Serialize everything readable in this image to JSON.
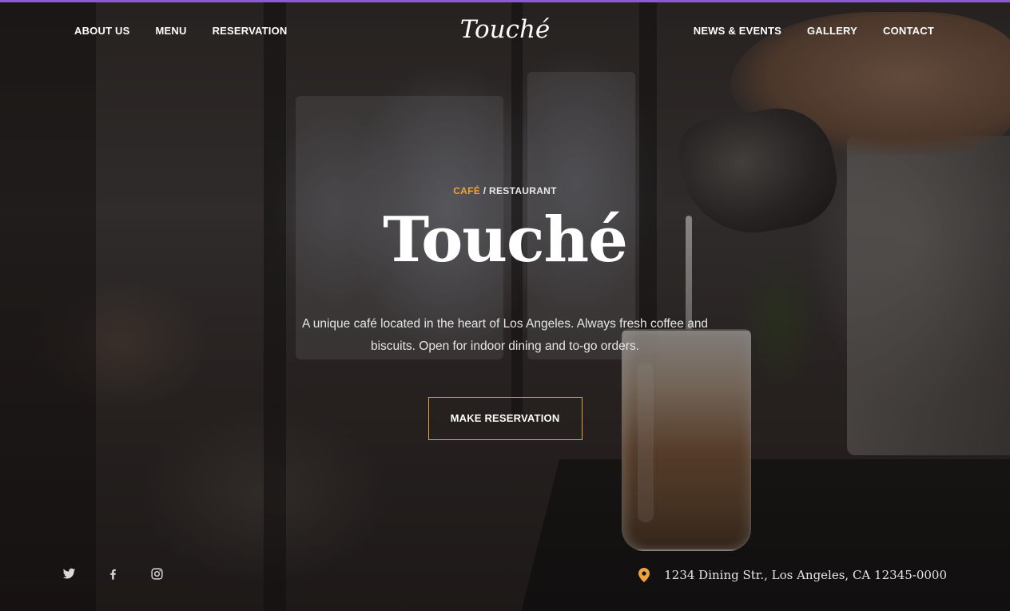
{
  "brand": {
    "logo": "Touché",
    "accent_color": "#f2a23a",
    "top_strip_color": "#8a5cd0"
  },
  "nav": {
    "left": [
      {
        "label": "ABOUT US"
      },
      {
        "label": "MENU"
      },
      {
        "label": "RESERVATION"
      }
    ],
    "right": [
      {
        "label": "NEWS & EVENTS"
      },
      {
        "label": "GALLERY"
      },
      {
        "label": "CONTACT"
      }
    ]
  },
  "hero": {
    "eyebrow_accent": "CAFÉ",
    "eyebrow_sep": " / ",
    "eyebrow_rest": "RESTAURANT",
    "title": "Touché",
    "description": "A unique café located in the heart of Los Angeles. Always fresh coffee and biscuits. Open for indoor dining and to-go orders.",
    "cta_label": "MAKE RESERVATION"
  },
  "footer": {
    "social_icons": [
      "twitter-icon",
      "facebook-icon",
      "instagram-icon"
    ],
    "address": "1234 Dining Str., Los Angeles, CA 12345-0000"
  }
}
